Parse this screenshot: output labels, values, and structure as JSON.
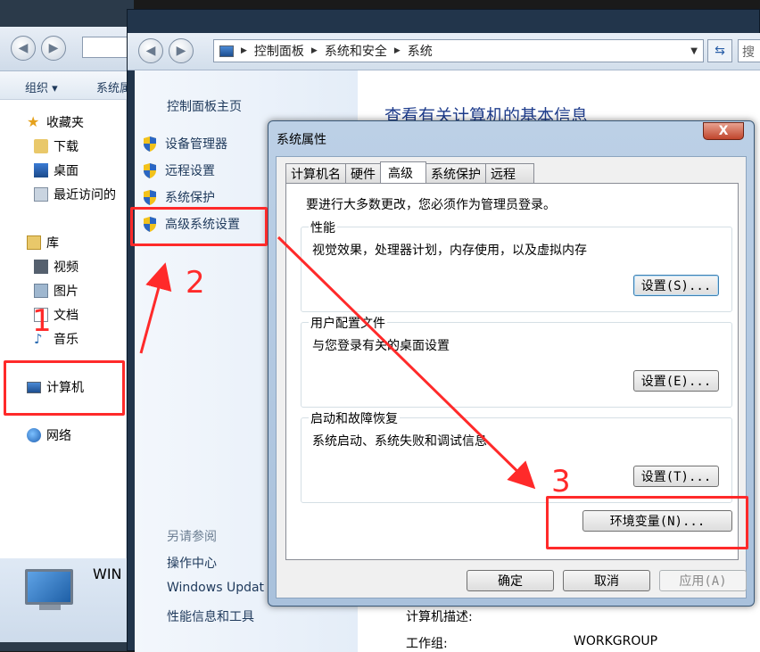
{
  "explorer": {
    "toolbar": [
      "组织 ▾",
      "系统属"
    ],
    "favorites_label": "收藏夹",
    "downloads_label": "下载",
    "desktop_label": "桌面",
    "recent_label": "最近访问的",
    "libraries_label": "库",
    "videos_label": "视频",
    "pictures_label": "图片",
    "documents_label": "文档",
    "music_label": "音乐",
    "computer_label": "计算机",
    "network_label": "网络",
    "pc_name": "WIN"
  },
  "control_panel": {
    "breadcrumb": [
      "控制面板",
      "系统和安全",
      "系统"
    ],
    "search_placeholder": "搜",
    "home_link": "控制面板主页",
    "links": [
      "设备管理器",
      "远程设置",
      "系统保护",
      "高级系统设置"
    ],
    "see_also": "另请参阅",
    "see_also_links": [
      "操作中心",
      "Windows Updat",
      "性能信息和工具"
    ],
    "title": "查看有关计算机的基本信息",
    "computer_desc_label": "计算机描述:",
    "workgroup_label": "工作组:",
    "workgroup_value": "WORKGROUP"
  },
  "dialog": {
    "title": "系统属性",
    "close_label": "X",
    "tabs": [
      "计算机名",
      "硬件",
      "高级",
      "系统保护",
      "远程"
    ],
    "active_tab": "高级",
    "admin_note": "要进行大多数更改，您必须作为管理员登录。",
    "performance_title": "性能",
    "performance_desc": "视觉效果，处理器计划，内存使用，以及虚拟内存",
    "performance_button": "设置(S)...",
    "profile_title": "用户配置文件",
    "profile_desc": "与您登录有关的桌面设置",
    "profile_button": "设置(E)...",
    "startup_title": "启动和故障恢复",
    "startup_desc": "系统启动、系统失败和调试信息",
    "startup_button": "设置(T)...",
    "env_button": "环境变量(N)...",
    "ok_button": "确定",
    "cancel_button": "取消",
    "apply_button": "应用(A)"
  },
  "annotations": {
    "step1": "1",
    "step2": "2",
    "step3": "3",
    "color": "#ff2a2a"
  }
}
